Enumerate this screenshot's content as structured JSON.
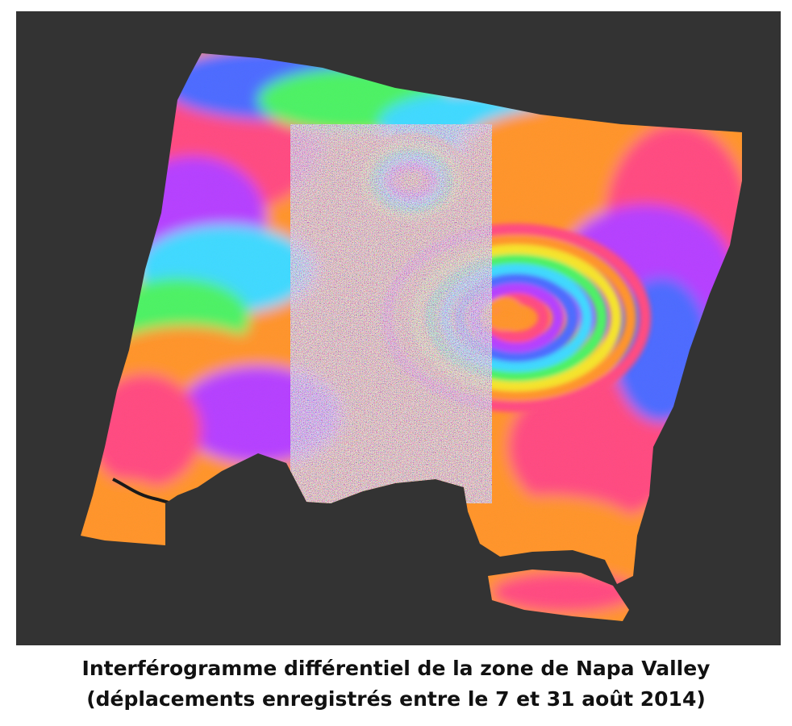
{
  "image": {
    "subject": "interferogram",
    "background_color": "#333333",
    "palette": [
      "#ff3c78",
      "#ff8c1a",
      "#f5e21b",
      "#41f05a",
      "#30d6ff",
      "#4060ff",
      "#b030ff"
    ]
  },
  "caption": {
    "line1": "Interférogramme différentiel de la zone de Napa Valley",
    "line2": "(déplacements enregistrés entre le 7 et 31 août 2014)"
  }
}
